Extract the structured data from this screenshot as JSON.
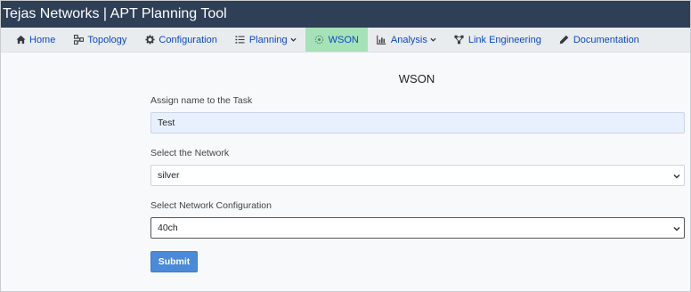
{
  "window": {
    "title": "Tejas Networks | APT Planning Tool"
  },
  "nav": {
    "items": [
      {
        "label": "Home",
        "icon": "home-icon"
      },
      {
        "label": "Topology",
        "icon": "topology-icon"
      },
      {
        "label": "Configuration",
        "icon": "gear-icon"
      },
      {
        "label": "Planning",
        "icon": "list-icon",
        "dropdown": true
      },
      {
        "label": "WSON",
        "icon": "wson-icon",
        "active": true
      },
      {
        "label": "Analysis",
        "icon": "chart-icon",
        "dropdown": true
      },
      {
        "label": "Link Engineering",
        "icon": "link-network-icon"
      },
      {
        "label": "Documentation",
        "icon": "pencil-icon"
      }
    ],
    "active_color": "#a5e2b7",
    "link_color": "#0d47c7"
  },
  "page": {
    "heading": "WSON",
    "task_name": {
      "label": "Assign name to the Task",
      "value": "Test"
    },
    "network": {
      "label": "Select the Network",
      "value": "silver"
    },
    "network_config": {
      "label": "Select Network Configuration",
      "value": "40ch"
    },
    "submit_label": "Submit"
  },
  "colors": {
    "titlebar": "#2e3f56",
    "submit": "#4b8ad8"
  }
}
